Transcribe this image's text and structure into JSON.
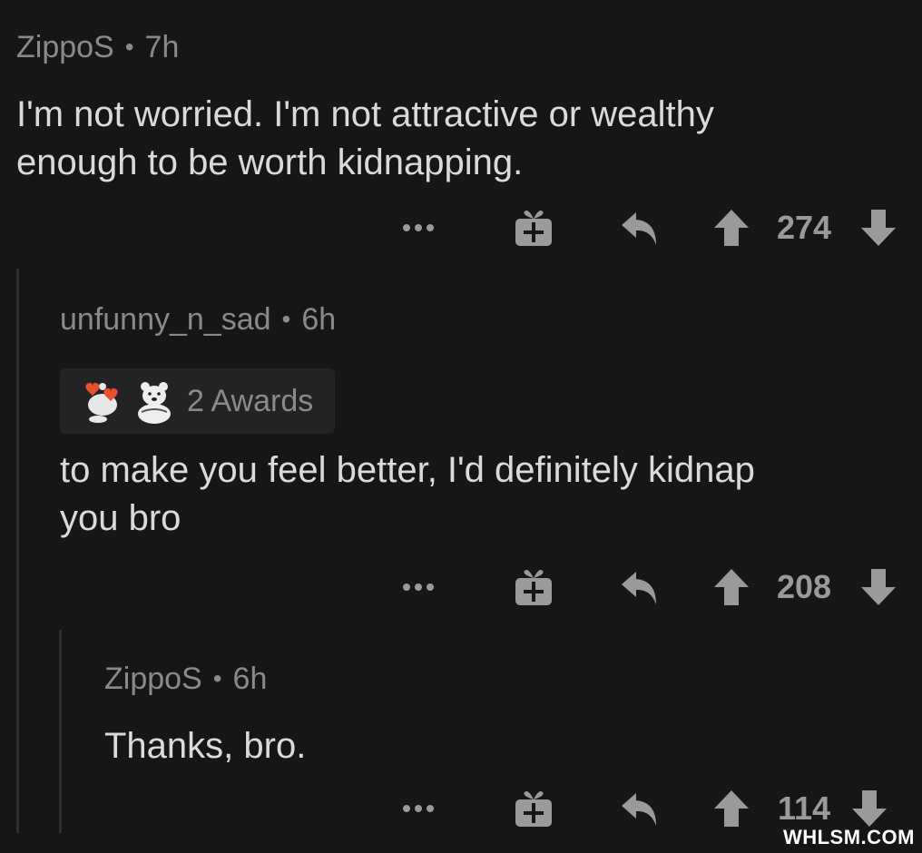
{
  "comments": [
    {
      "username": "ZippoS",
      "time": "7h",
      "text_lines": [
        "I'm not worried. I'm not attractive or wealthy",
        "enough to be worth kidnapping."
      ],
      "score": "274"
    },
    {
      "username": "unfunny_n_sad",
      "time": "6h",
      "awards_label": "2 Awards",
      "award_icons": [
        "heart-eyes-snoo-icon",
        "polar-bear-icon"
      ],
      "text_lines": [
        "to make you feel better, I'd definitely kidnap",
        "you bro"
      ],
      "score": "208"
    },
    {
      "username": "ZippoS",
      "time": "6h",
      "text_lines": [
        "Thanks, bro."
      ],
      "score": "114"
    }
  ],
  "separator": "•",
  "more_label": "•••",
  "watermark": "WHLSM.COM",
  "colors": {
    "background": "#161617",
    "meta_text": "#8a8a8c",
    "body_text": "#dadadc",
    "icon": "#9a9a9c",
    "awards_bg": "#232325"
  }
}
